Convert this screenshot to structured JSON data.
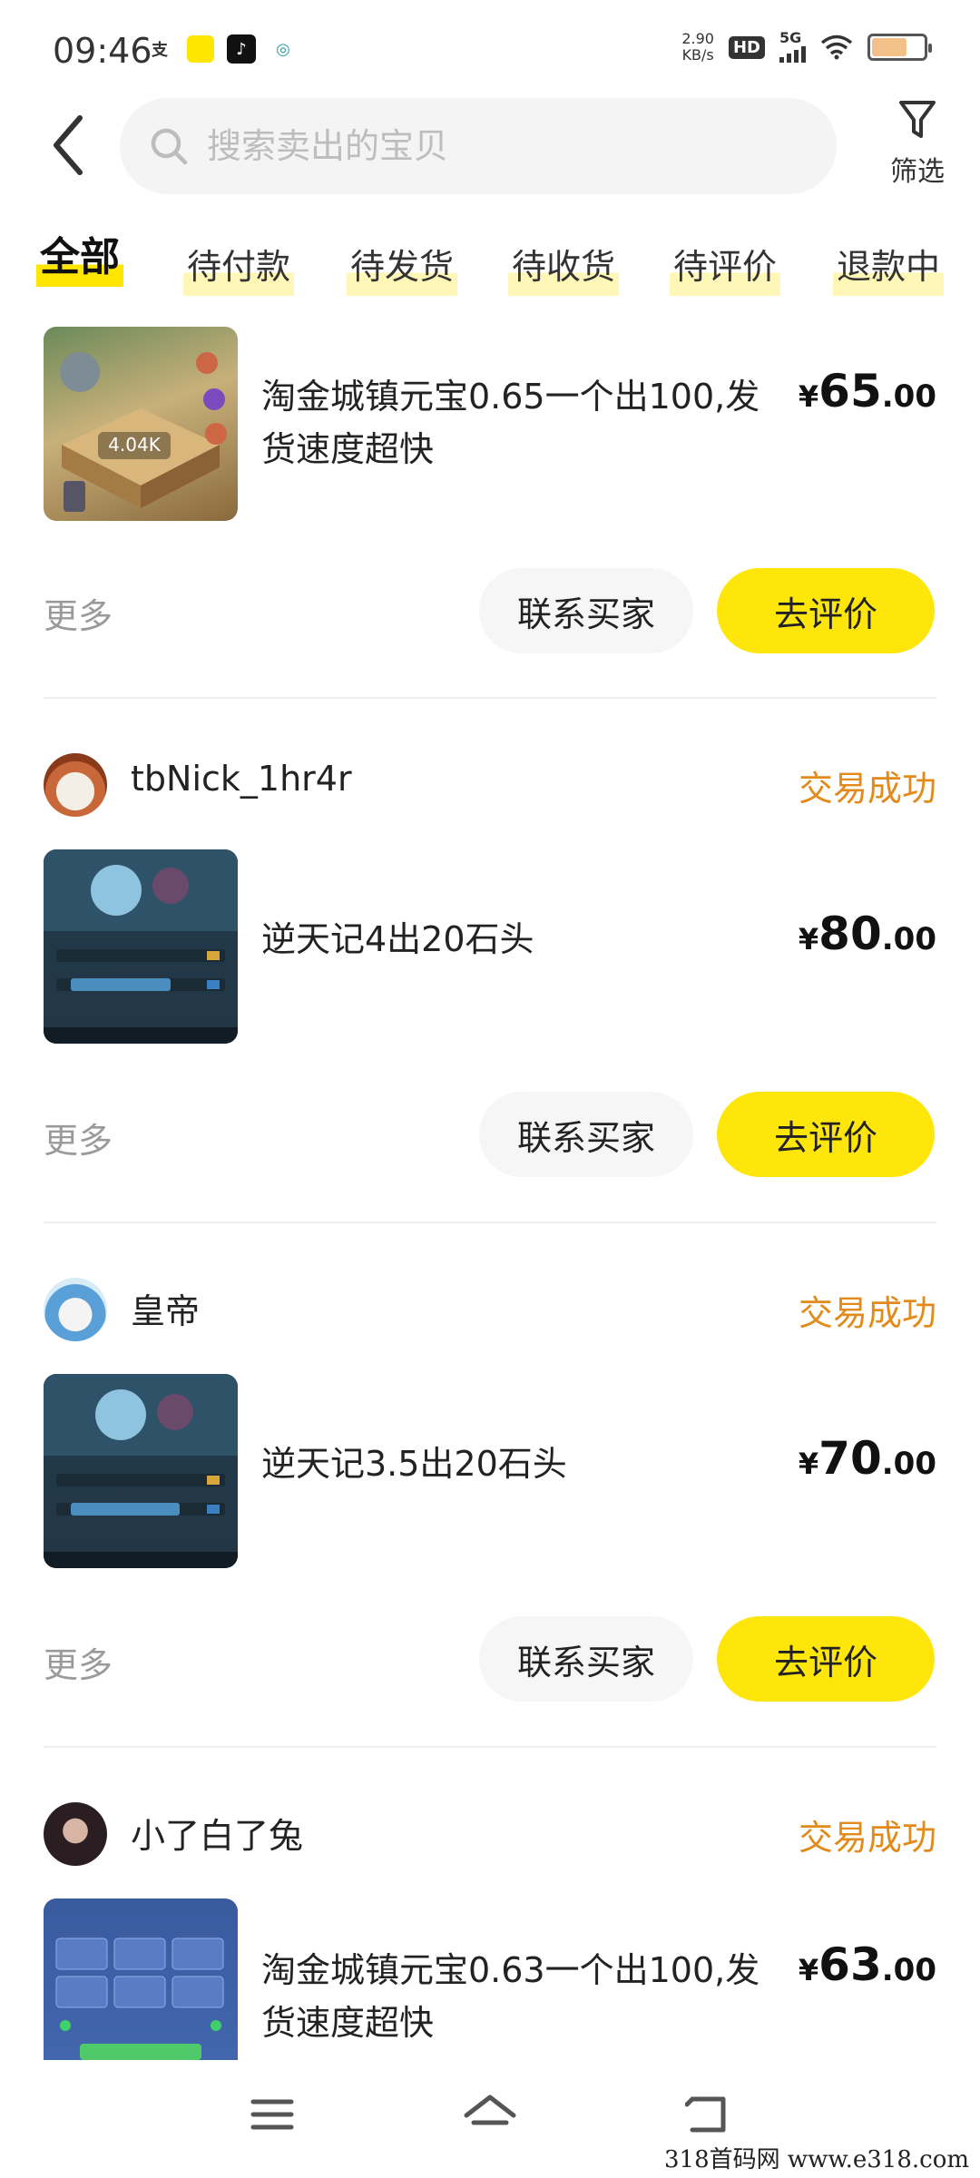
{
  "status_bar": {
    "time": "09:46",
    "net_speed_value": "2.90",
    "net_speed_unit": "KB/s",
    "hd": "HD",
    "network": "5G",
    "battery_level": 0.7
  },
  "header": {
    "search_placeholder": "搜索卖出的宝贝",
    "filter_label": "筛选"
  },
  "tabs": [
    {
      "label": "全部",
      "active": true
    },
    {
      "label": "待付款"
    },
    {
      "label": "待发货"
    },
    {
      "label": "待收货"
    },
    {
      "label": "待评价"
    },
    {
      "label": "退款中"
    }
  ],
  "orders": [
    {
      "title": "淘金城镇元宝0.65一个出100,发货速度超快",
      "price_currency": "¥",
      "price_int": "65",
      "price_dec": ".00",
      "more_label": "更多",
      "contact_label": "联系买家",
      "rate_label": "去评价"
    },
    {
      "seller": "tbNick_1hr4r",
      "status": "交易成功",
      "title": "逆天记4出20石头",
      "price_currency": "¥",
      "price_int": "80",
      "price_dec": ".00",
      "more_label": "更多",
      "contact_label": "联系买家",
      "rate_label": "去评价"
    },
    {
      "seller": "皇帝",
      "status": "交易成功",
      "title": "逆天记3.5出20石头",
      "price_currency": "¥",
      "price_int": "70",
      "price_dec": ".00",
      "more_label": "更多",
      "contact_label": "联系买家",
      "rate_label": "去评价"
    },
    {
      "seller": "小了白了兔",
      "status": "交易成功",
      "title": "淘金城镇元宝0.63一个出100,发货速度超快",
      "price_currency": "¥",
      "price_int": "63",
      "price_dec": ".00"
    }
  ],
  "thumb_texts": {
    "game_badge": "4.04K"
  },
  "watermark": "318首码网  www.e318.com",
  "colors": {
    "accent_yellow": "#ffe60a",
    "status_orange": "#e28a1a",
    "muted_gray": "#9a9a9a"
  }
}
